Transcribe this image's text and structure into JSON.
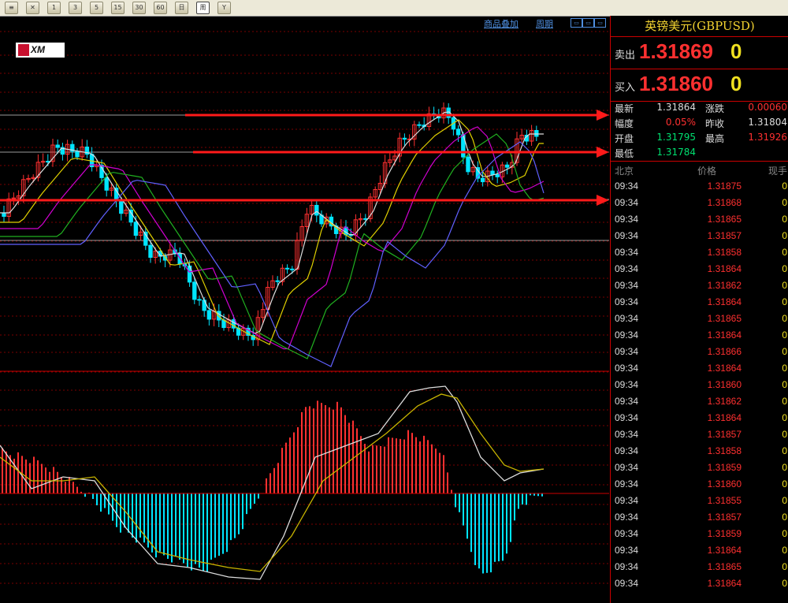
{
  "toolbar": {
    "buttons": [
      "menu-icon",
      "crosshair-icon",
      "1",
      "3",
      "5",
      "15",
      "30",
      "60",
      "day-icon",
      "week-icon",
      "filter-icon"
    ],
    "active_index": 9
  },
  "chart_links": {
    "overlay": "商品叠加",
    "period": "周期"
  },
  "logo": {
    "text": "XM"
  },
  "quote": {
    "title": "英镑美元(GBPUSD)",
    "sell_label": "卖出",
    "sell_price": "1.31869",
    "sell_frac": "0",
    "buy_label": "买入",
    "buy_price": "1.31860",
    "buy_frac": "0",
    "stats": [
      {
        "label": "最新",
        "value": "1.31864",
        "label2": "涨跌",
        "value2": "0.00060"
      },
      {
        "label": "幅度",
        "value": "0.05%",
        "label2": "昨收",
        "value2": "1.31804"
      },
      {
        "label": "开盘",
        "value": "1.31795",
        "label2": "最高",
        "value2": "1.31926"
      },
      {
        "label": "最低",
        "value": "1.31784",
        "label2": "",
        "value2": ""
      }
    ],
    "ticks_header": {
      "time": "北京",
      "price": "价格",
      "volume": "现手"
    },
    "ticks": [
      {
        "time": "09:34",
        "price": "1.31875",
        "vol": "0"
      },
      {
        "time": "09:34",
        "price": "1.31868",
        "vol": "0"
      },
      {
        "time": "09:34",
        "price": "1.31865",
        "vol": "0"
      },
      {
        "time": "09:34",
        "price": "1.31857",
        "vol": "0"
      },
      {
        "time": "09:34",
        "price": "1.31858",
        "vol": "0"
      },
      {
        "time": "09:34",
        "price": "1.31864",
        "vol": "0"
      },
      {
        "time": "09:34",
        "price": "1.31862",
        "vol": "0"
      },
      {
        "time": "09:34",
        "price": "1.31864",
        "vol": "0"
      },
      {
        "time": "09:34",
        "price": "1.31865",
        "vol": "0"
      },
      {
        "time": "09:34",
        "price": "1.31864",
        "vol": "0"
      },
      {
        "time": "09:34",
        "price": "1.31866",
        "vol": "0"
      },
      {
        "time": "09:34",
        "price": "1.31864",
        "vol": "0"
      },
      {
        "time": "09:34",
        "price": "1.31860",
        "vol": "0"
      },
      {
        "time": "09:34",
        "price": "1.31862",
        "vol": "0"
      },
      {
        "time": "09:34",
        "price": "1.31864",
        "vol": "0"
      },
      {
        "time": "09:34",
        "price": "1.31857",
        "vol": "0"
      },
      {
        "time": "09:34",
        "price": "1.31858",
        "vol": "0"
      },
      {
        "time": "09:34",
        "price": "1.31859",
        "vol": "0"
      },
      {
        "time": "09:34",
        "price": "1.31860",
        "vol": "0"
      },
      {
        "time": "09:34",
        "price": "1.31855",
        "vol": "0"
      },
      {
        "time": "09:34",
        "price": "1.31857",
        "vol": "0"
      },
      {
        "time": "09:34",
        "price": "1.31859",
        "vol": "0"
      },
      {
        "time": "09:34",
        "price": "1.31864",
        "vol": "0"
      },
      {
        "time": "09:34",
        "price": "1.31865",
        "vol": "0"
      },
      {
        "time": "09:34",
        "price": "1.31864",
        "vol": "0"
      }
    ]
  },
  "colors": {
    "up": "#ff3030",
    "down": "#00e5ff",
    "arrow": "#ff1a1a",
    "grid": "#7a0000"
  }
}
